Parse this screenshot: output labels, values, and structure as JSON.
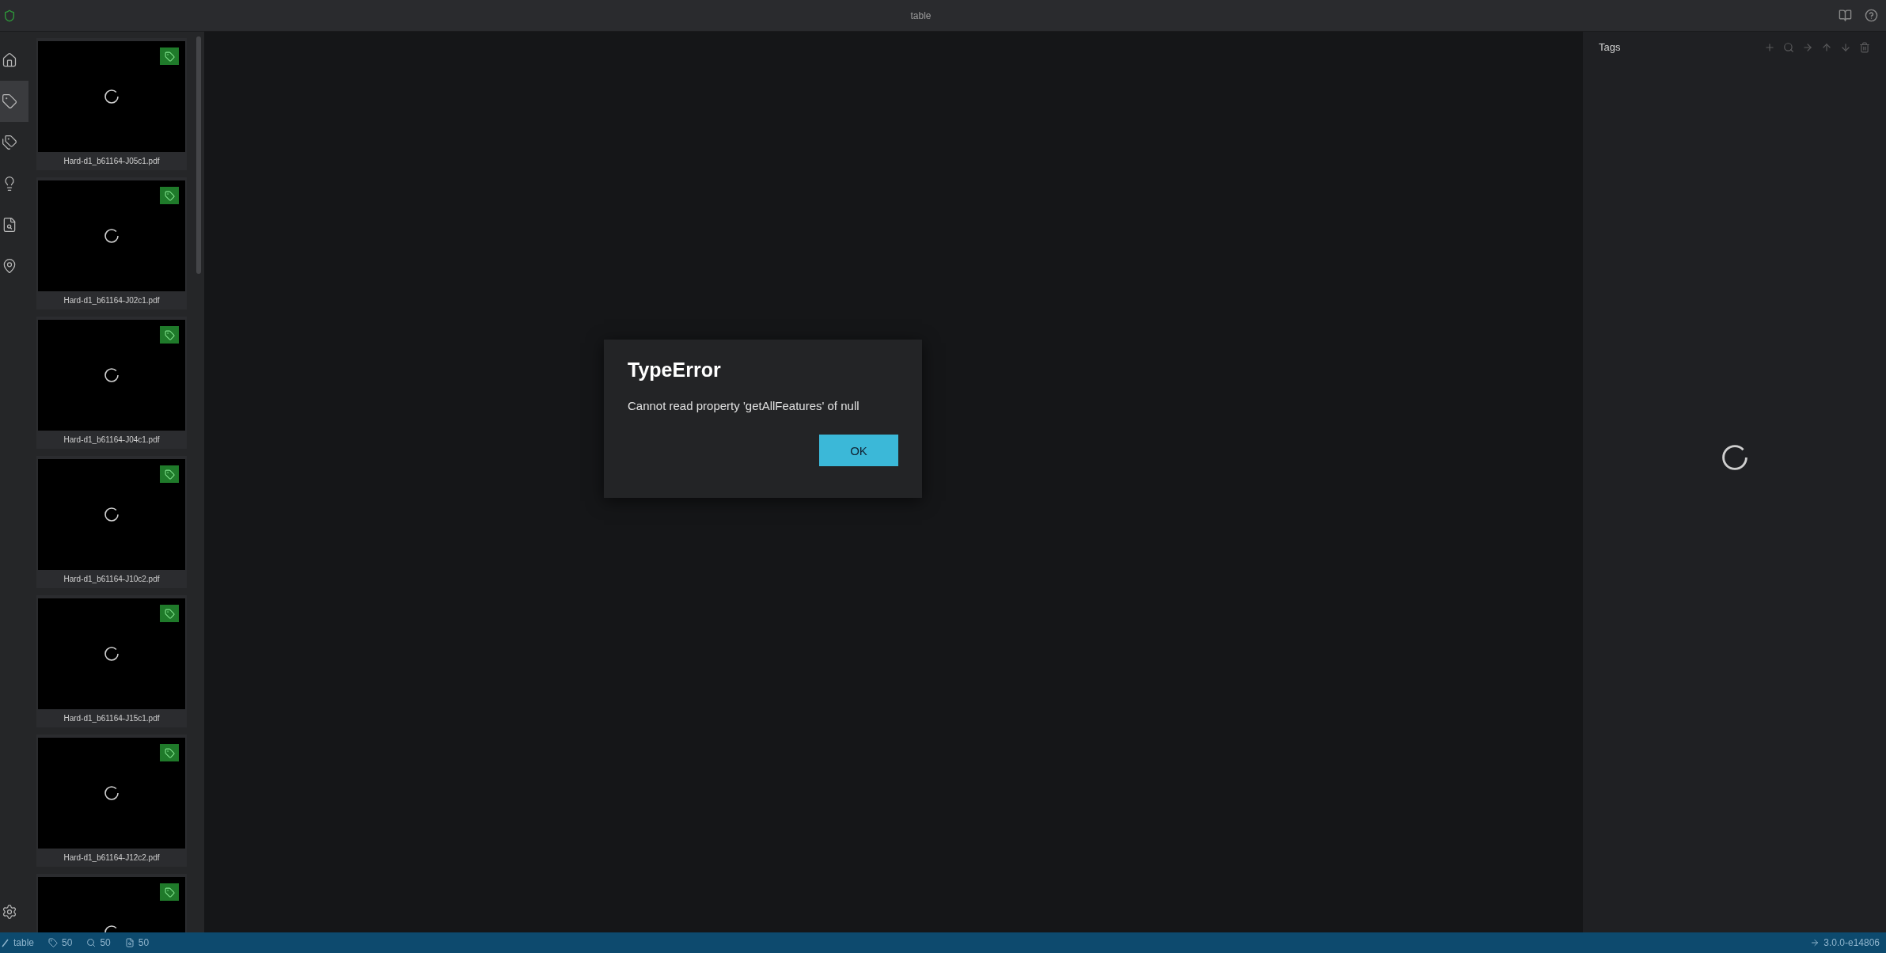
{
  "window": {
    "title": "table"
  },
  "sidebar": {
    "items": [
      {
        "kind": "home",
        "selected": false
      },
      {
        "kind": "tag",
        "selected": true
      },
      {
        "kind": "tags",
        "selected": false
      },
      {
        "kind": "bulb",
        "selected": false
      },
      {
        "kind": "file",
        "selected": false
      },
      {
        "kind": "pin",
        "selected": false
      }
    ]
  },
  "thumbnails": [
    {
      "label": "Hard-d1_b61164-J05c1.pdf",
      "tagged": true
    },
    {
      "label": "Hard-d1_b61164-J02c1.pdf",
      "tagged": true
    },
    {
      "label": "Hard-d1_b61164-J04c1.pdf",
      "tagged": true
    },
    {
      "label": "Hard-d1_b61164-J10c2.pdf",
      "tagged": true
    },
    {
      "label": "Hard-d1_b61164-J15c1.pdf",
      "tagged": true
    },
    {
      "label": "Hard-d1_b61164-J12c2.pdf",
      "tagged": true
    },
    {
      "tagged": true
    }
  ],
  "tags_panel": {
    "title": "Tags"
  },
  "dialog": {
    "title": "TypeError",
    "message": "Cannot read property 'getAllFeatures' of null",
    "button": "OK"
  },
  "status_bar": {
    "project": "table",
    "tags": "50",
    "visited": "50",
    "assets": "50",
    "version": "3.0.0-e14806"
  }
}
